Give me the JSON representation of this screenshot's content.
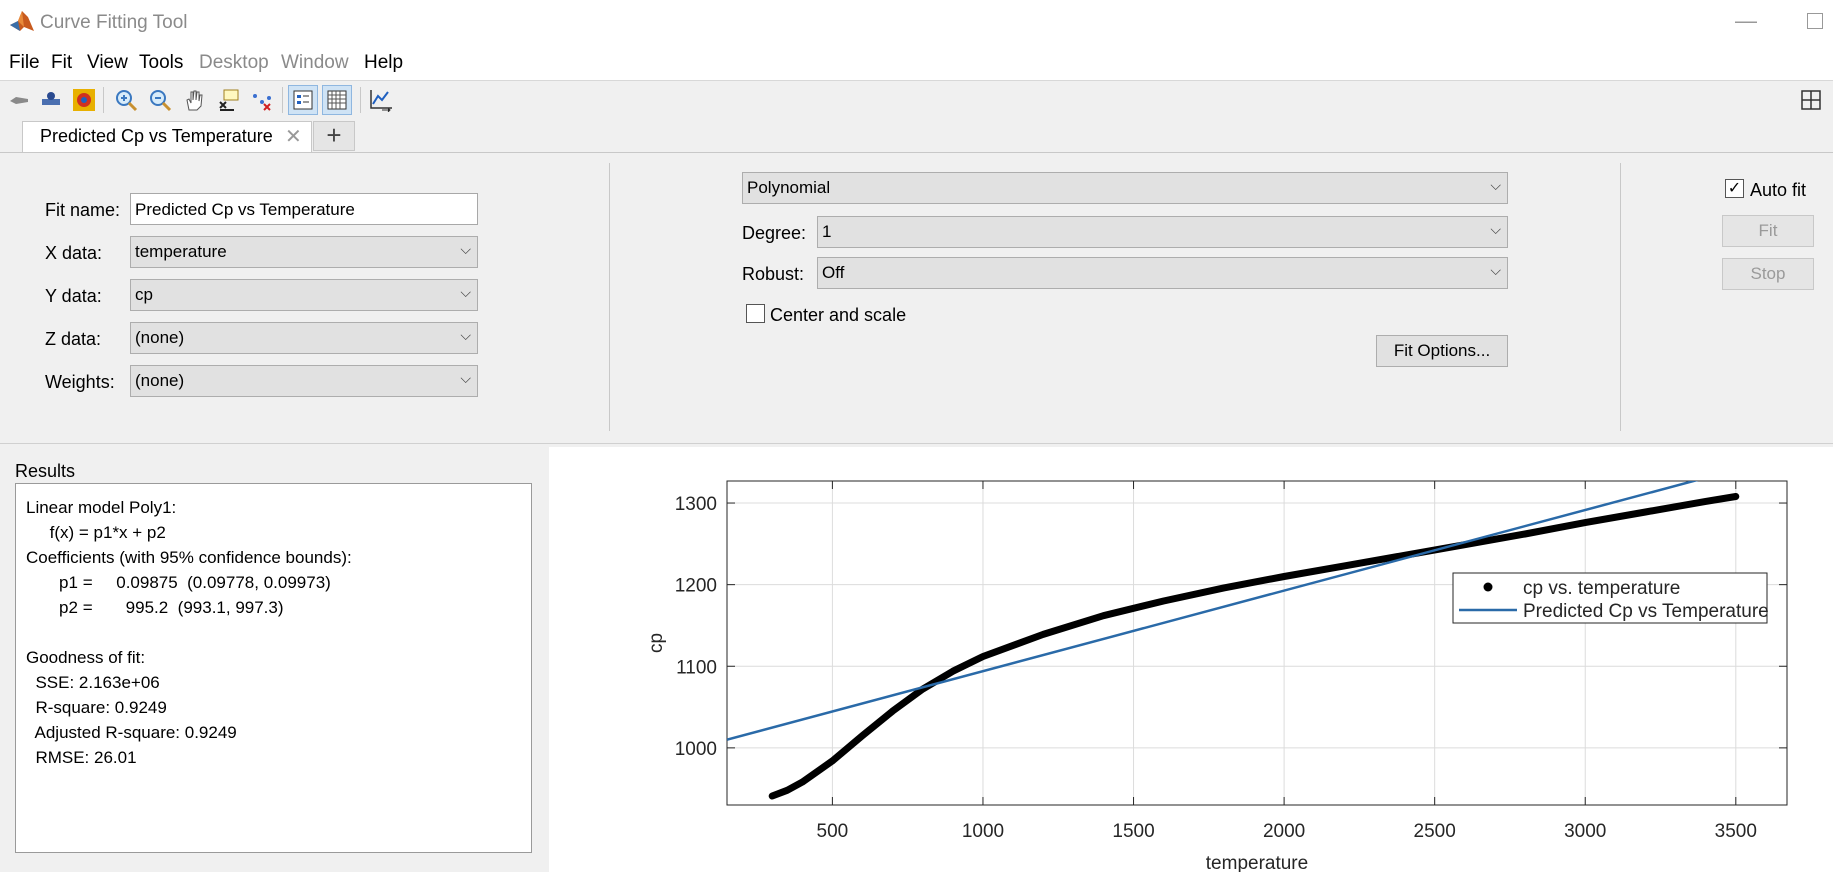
{
  "window": {
    "title": "Curve Fitting Tool"
  },
  "menu": [
    "File",
    "Fit",
    "View",
    "Tools",
    "Desktop",
    "Window",
    "Help"
  ],
  "menu_disabled": [
    "Desktop",
    "Window"
  ],
  "tabs": {
    "active": "Predicted Cp vs Temperature",
    "add": "+"
  },
  "fit_settings": {
    "fit_name_label": "Fit name:",
    "fit_name_value": "Predicted Cp vs Temperature",
    "x_label": "X data:",
    "x_value": "temperature",
    "y_label": "Y data:",
    "y_value": "cp",
    "z_label": "Z data:",
    "z_value": "(none)",
    "w_label": "Weights:",
    "w_value": "(none)",
    "model": "Polynomial",
    "degree_label": "Degree:",
    "degree_value": "1",
    "robust_label": "Robust:",
    "robust_value": "Off",
    "center_scale_label": "Center and scale",
    "center_scale_checked": false,
    "fit_options_button": "Fit Options...",
    "auto_fit_label": "Auto fit",
    "auto_fit_checked": true,
    "fit_button": "Fit",
    "stop_button": "Stop"
  },
  "results": {
    "title": "Results",
    "lines": [
      "Linear model Poly1:",
      "     f(x) = p1*x + p2",
      "Coefficients (with 95% confidence bounds):",
      "       p1 =     0.09875  (0.09778, 0.09973)",
      "       p2 =       995.2  (993.1, 997.3)",
      "",
      "Goodness of fit:",
      "  SSE: 2.163e+06",
      "  R-square: 0.9249",
      "  Adjusted R-square: 0.9249",
      "  RMSE: 26.01"
    ]
  },
  "chart_data": {
    "type": "line",
    "xlabel": "temperature",
    "ylabel": "cp",
    "xlim": [
      150,
      3670
    ],
    "ylim": [
      930,
      1327
    ],
    "xticks": [
      500,
      1000,
      1500,
      2000,
      2500,
      3000,
      3500
    ],
    "yticks": [
      1000,
      1100,
      1200,
      1300
    ],
    "grid": true,
    "legend_position": "right",
    "series": [
      {
        "name": "cp vs. temperature",
        "style": "dots",
        "color": "#000000",
        "x": [
          300,
          350,
          400,
          500,
          600,
          700,
          800,
          900,
          1000,
          1200,
          1400,
          1600,
          1800,
          2000,
          2200,
          2400,
          2600,
          2800,
          3000,
          3200,
          3400,
          3500
        ],
        "y": [
          941,
          948,
          958,
          984,
          1015,
          1045,
          1072,
          1094,
          1112,
          1139,
          1162,
          1180,
          1196,
          1210,
          1223,
          1236,
          1249,
          1262,
          1276,
          1289,
          1302,
          1308
        ]
      },
      {
        "name": "Predicted Cp vs Temperature",
        "style": "line",
        "color": "#2a6aa8",
        "x": [
          150,
          3670
        ],
        "y": [
          1010.0,
          1357.6
        ]
      }
    ]
  },
  "colors": {
    "fit_line": "#2a6aa8",
    "data": "#000000",
    "accent": "#cfe3f5"
  }
}
